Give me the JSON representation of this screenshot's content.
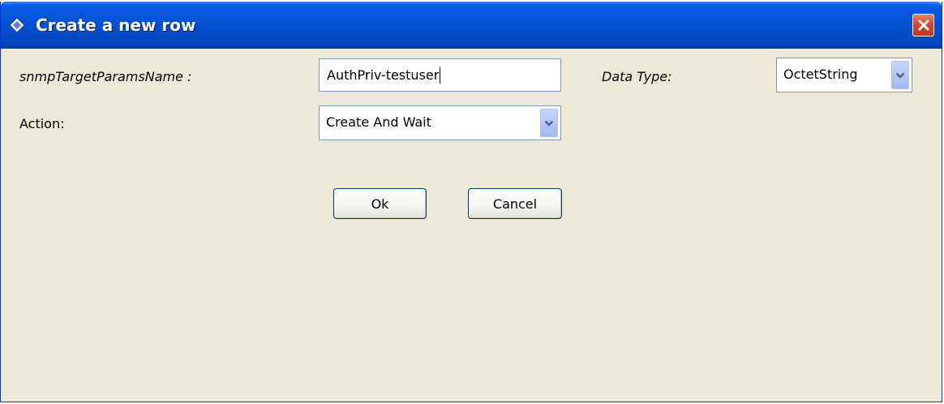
{
  "window": {
    "title": "Create a new row",
    "icon": "diamond-app-icon",
    "close_icon": "close-icon"
  },
  "form": {
    "param_label": "snmpTargetParamsName :",
    "param_value": "AuthPriv-testuser",
    "data_type_label": "Data Type:",
    "data_type_value": "OctetString",
    "action_label": "Action:",
    "action_value": "Create And Wait"
  },
  "buttons": {
    "ok_label": "Ok",
    "cancel_label": "Cancel"
  },
  "colors": {
    "title_bar": "#0553D5",
    "dialog_bg": "#ECE9D8",
    "close_button": "#D6462C"
  }
}
